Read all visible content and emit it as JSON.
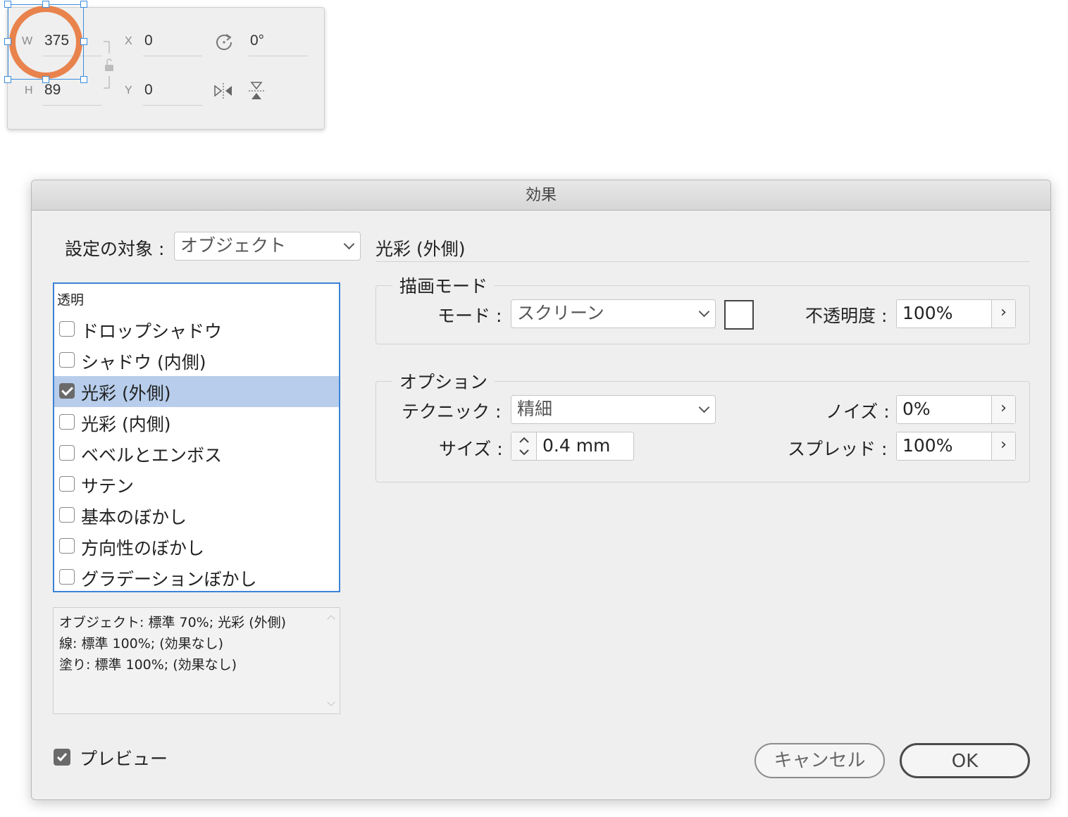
{
  "transform_panel": {
    "w_label": "W",
    "w_value": "375",
    "h_label": "H",
    "h_value": "89",
    "x_label": "X",
    "x_value": "0",
    "y_label": "Y",
    "y_value": "0",
    "rotation_value": "0°",
    "icons": [
      "rotate-icon",
      "flip-horizontal-icon",
      "flip-vertical-icon",
      "constrain-lock-icon"
    ],
    "accent": "#e9834d",
    "selection_color": "#3c8dde"
  },
  "dialog": {
    "title": "効果",
    "target_label": "設定の対象 :",
    "target_value": "オブジェクト",
    "list": {
      "header": "透明",
      "items": [
        {
          "label": "ドロップシャドウ",
          "checked": false,
          "selected": false
        },
        {
          "label": "シャドウ (内側)",
          "checked": false,
          "selected": false
        },
        {
          "label": "光彩 (外側)",
          "checked": true,
          "selected": true
        },
        {
          "label": "光彩 (内側)",
          "checked": false,
          "selected": false
        },
        {
          "label": "ベベルとエンボス",
          "checked": false,
          "selected": false
        },
        {
          "label": "サテン",
          "checked": false,
          "selected": false
        },
        {
          "label": "基本のぼかし",
          "checked": false,
          "selected": false
        },
        {
          "label": "方向性のぼかし",
          "checked": false,
          "selected": false
        },
        {
          "label": "グラデーションぼかし",
          "checked": false,
          "selected": false
        }
      ]
    },
    "summary": {
      "line1": "オブジェクト: 標準 70%; 光彩 (外側)",
      "line2": "線: 標準 100%; (効果なし)",
      "line3": "塗り: 標準 100%; (効果なし)"
    },
    "section_title": "光彩 (外側)",
    "blend_group": {
      "title": "描画モード",
      "mode_label": "モード :",
      "mode_value": "スクリーン",
      "swatch_color": "#ffffff",
      "opacity_label": "不透明度 :",
      "opacity_value": "100%"
    },
    "options_group": {
      "title": "オプション",
      "technique_label": "テクニック :",
      "technique_value": "精細",
      "size_label": "サイズ :",
      "size_value": "0.4 mm",
      "noise_label": "ノイズ :",
      "noise_value": "0%",
      "spread_label": "スプレッド :",
      "spread_value": "100%"
    },
    "preview_label": "プレビュー",
    "preview_checked": true,
    "cancel_label": "キャンセル",
    "ok_label": "OK",
    "selection_highlight": "#b7cdeb",
    "list_border": "#3b82d6"
  }
}
